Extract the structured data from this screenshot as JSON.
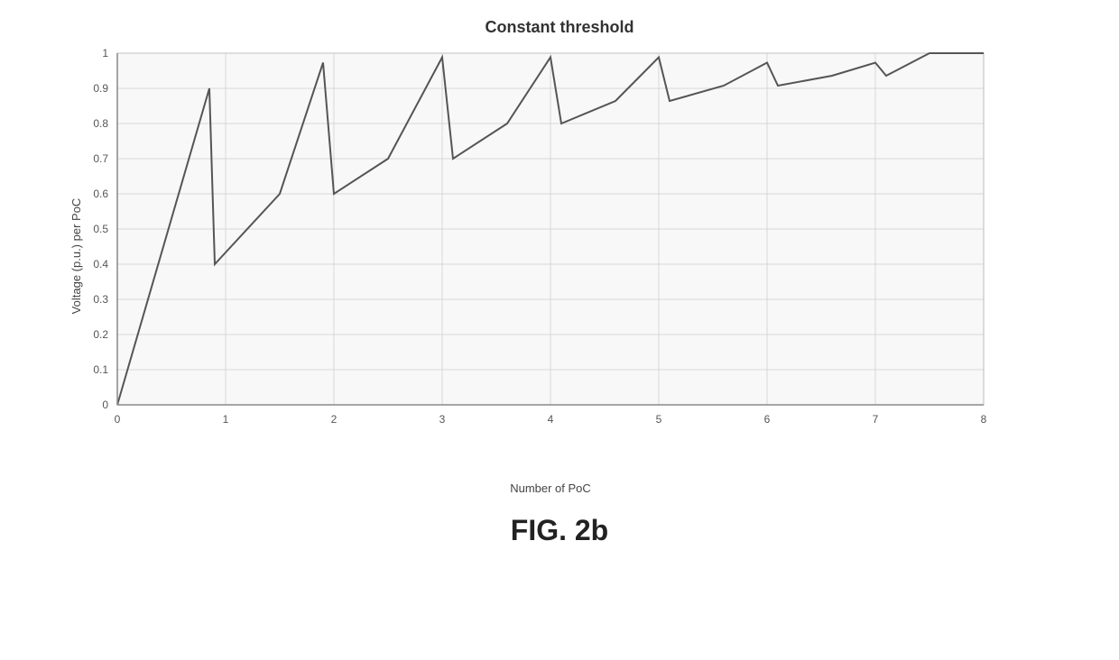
{
  "title": "Constant threshold",
  "yAxisLabel": "Voltage (p.u.) per PoC",
  "xAxisLabel": "Number of PoC",
  "figLabel": "FIG. 2b",
  "xTicks": [
    "0",
    "1",
    "2",
    "3",
    "4",
    "5",
    "6",
    "7",
    "8"
  ],
  "yTicks": [
    "0",
    "0.1",
    "0.2",
    "0.3",
    "0.4",
    "0.5",
    "0.6",
    "0.7",
    "0.8",
    "0.9",
    "1"
  ],
  "colors": {
    "axis": "#999",
    "grid": "#cccccc",
    "curve": "#555555",
    "background": "#f5f5f5"
  }
}
